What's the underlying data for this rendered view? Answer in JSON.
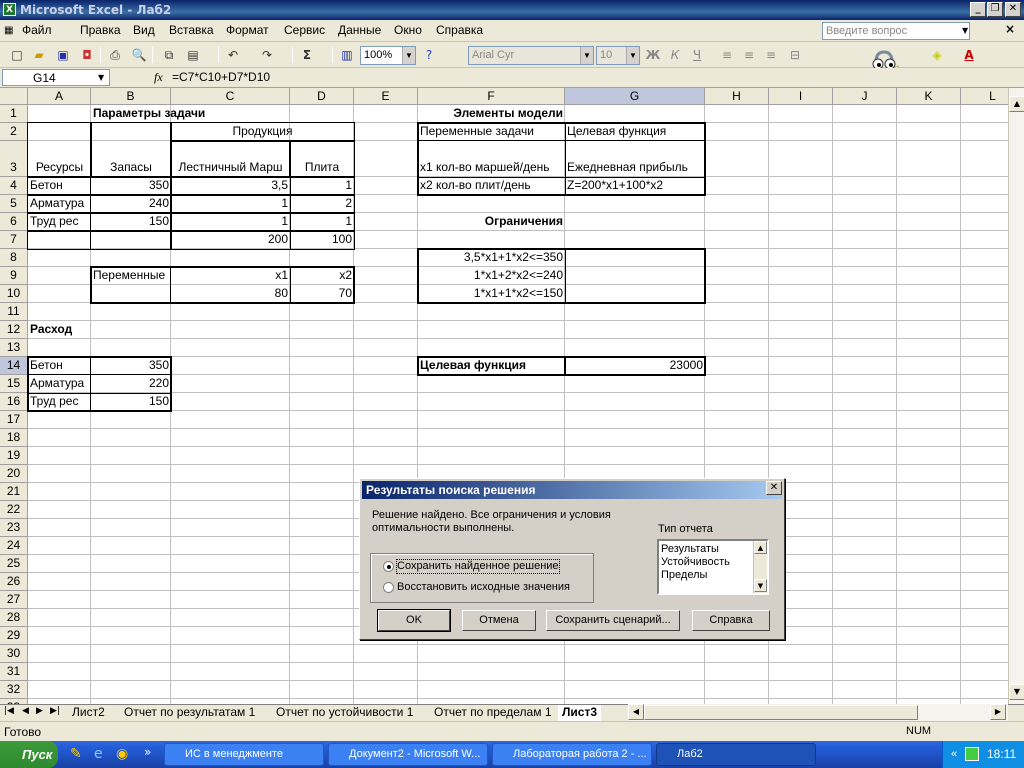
{
  "window": {
    "title": "Microsoft Excel - Лаб2"
  },
  "menu": [
    "Файл",
    "Правка",
    "Вид",
    "Вставка",
    "Формат",
    "Сервис",
    "Данные",
    "Окно",
    "Справка"
  ],
  "help_placeholder": "Введите вопрос",
  "toolbar": {
    "zoom": "100%",
    "font": "Arial Cyr",
    "size": "10"
  },
  "formula_bar": {
    "name_box": "G14",
    "fx": "fx",
    "formula": "=C7*C10+D7*D10"
  },
  "columns": [
    "A",
    "B",
    "C",
    "D",
    "E",
    "F",
    "G",
    "H",
    "I",
    "J",
    "K",
    "L"
  ],
  "rows": [
    "1",
    "2",
    "3",
    "4",
    "5",
    "6",
    "7",
    "8",
    "9",
    "10",
    "11",
    "12",
    "13",
    "14",
    "15",
    "16",
    "17",
    "18",
    "19",
    "20",
    "21",
    "22",
    "23",
    "24",
    "25",
    "26",
    "27",
    "28",
    "29",
    "30",
    "31",
    "32",
    "33"
  ],
  "cells": {
    "B1": "Параметры задачи",
    "C2": "Продукция",
    "A3": "Ресурсы",
    "B3": "Запасы",
    "C3": "Лестничный Марш",
    "D3": "Плита",
    "A4": "Бетон",
    "B4": "350",
    "C4": "3,5",
    "D4": "1",
    "A5": "Арматура",
    "B5": "240",
    "C5": "1",
    "D5": "2",
    "A6": "Труд рес",
    "B6": "150",
    "C6": "1",
    "D6": "1",
    "C7": "200",
    "D7": "100",
    "B9": "Переменные",
    "C9": "x1",
    "D9": "x2",
    "C10": "80",
    "D10": "70",
    "A12": "Расход",
    "A14": "Бетон",
    "B14": "350",
    "A15": "Арматура",
    "B15": "220",
    "A16": "Труд рес",
    "B16": "150",
    "F1": "Элементы модели",
    "F2": "Переменные задачи",
    "G2": "Целевая функция",
    "F3": "x1 кол-во маршей/день",
    "G3": "Ежедневная прибыль",
    "F4": "x2 кол-во плит/день",
    "G4": "Z=200*x1+100*x2",
    "F6": "Ограничения",
    "F8": "3,5*x1+1*x2<=350",
    "F9": "1*x1+2*x2<=240",
    "F10": "1*x1+1*x2<=150",
    "F14": "Целевая функция",
    "G14": "23000"
  },
  "sheet_tabs": [
    "Лист2",
    "Отчет по результатам 1",
    "Отчет по устойчивости 1",
    "Отчет по пределам 1",
    "Лист3"
  ],
  "status": {
    "left": "Готово",
    "num": "NUM"
  },
  "dialog": {
    "title": "Результаты поиска решения",
    "message": "Решение найдено. Все ограничения и условия оптимальности выполнены.",
    "report_label": "Тип отчета",
    "reports": [
      "Результаты",
      "Устойчивость",
      "Пределы"
    ],
    "option_keep": "Сохранить найденное решение",
    "option_restore": "Восстановить исходные значения",
    "btn_ok": "OK",
    "btn_cancel": "Отмена",
    "btn_save_scenario": "Сохранить сценарий...",
    "btn_help": "Справка"
  },
  "taskbar": {
    "start": "Пуск",
    "tasks": [
      "ИС в менеджменте",
      "Документ2 - Microsoft W...",
      "Лабораторая работа 2 - ...",
      "Лаб2"
    ],
    "clock": "18:11"
  }
}
